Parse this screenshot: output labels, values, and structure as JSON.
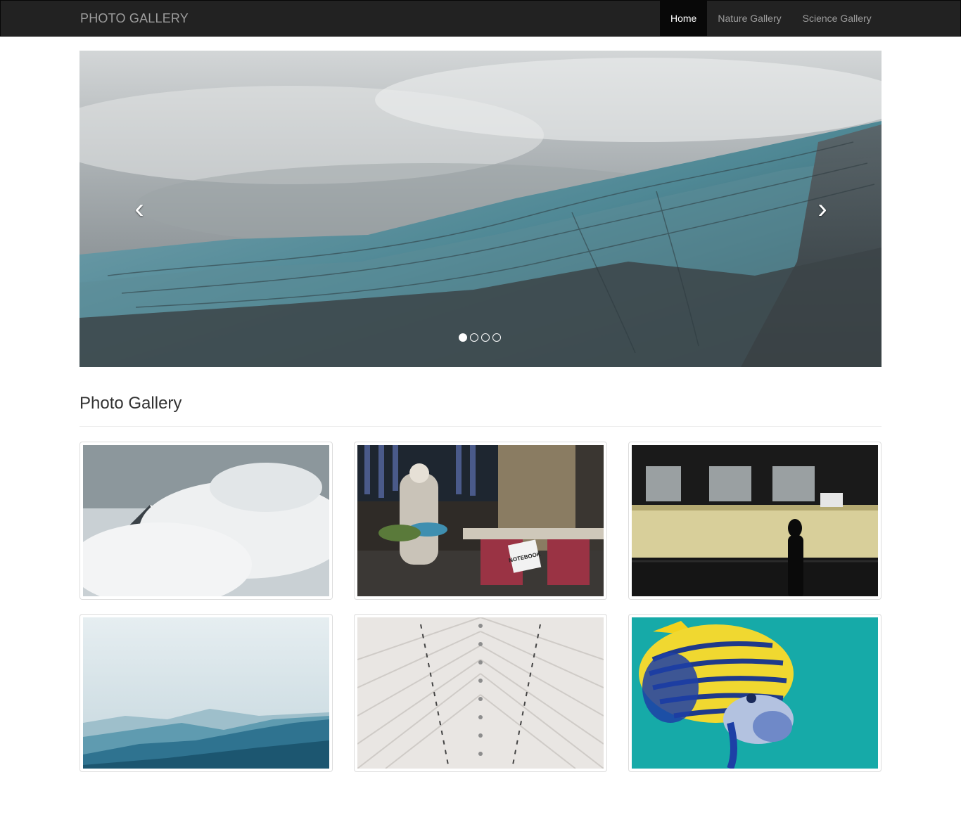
{
  "navbar": {
    "brand": "PHOTO GALLERY",
    "items": [
      {
        "label": "Home",
        "active": true
      },
      {
        "label": "Nature Gallery",
        "active": false
      },
      {
        "label": "Science Gallery",
        "active": false
      }
    ]
  },
  "carousel": {
    "prev_icon": "chevron-left-icon",
    "next_icon": "chevron-right-icon",
    "prev_glyph": "‹",
    "next_glyph": "›",
    "slide_count": 4,
    "active_slide": 1
  },
  "gallery": {
    "title": "Photo Gallery",
    "sign_text": "NOTEBOOK"
  },
  "colors": {
    "navbar_bg": "#222222",
    "nav_active_bg": "#080808",
    "nav_text": "#9d9d9d"
  }
}
